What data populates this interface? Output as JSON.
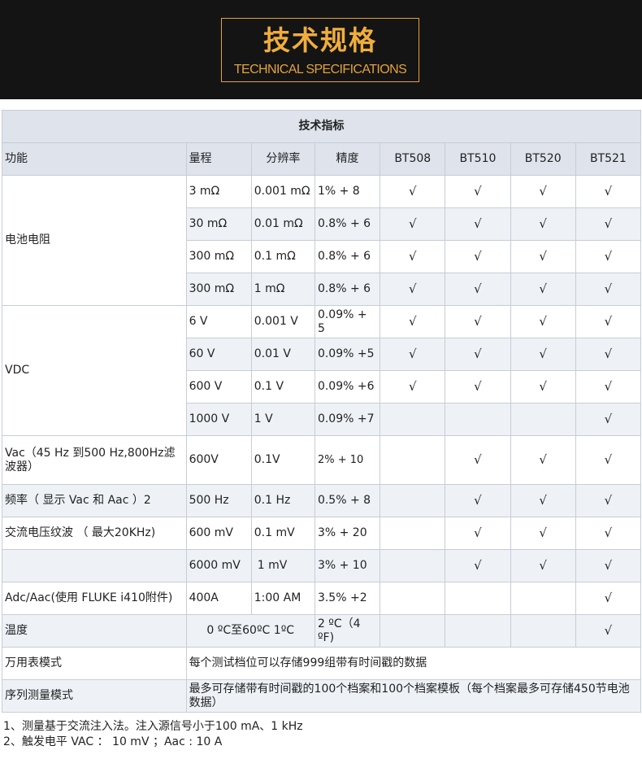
{
  "banner": {
    "title_cn": "技术规格",
    "title_en": "TECHNICAL SPECIFICATIONS"
  },
  "table": {
    "title": "技术指标",
    "headers": [
      "功能",
      "量程",
      "分辨率",
      "精度",
      "BT508",
      "BT510",
      "BT520",
      "BT521"
    ],
    "check": "√",
    "groups": [
      {
        "func": "电池电阻",
        "rows": [
          {
            "range": "3 mΩ",
            "res": "0.001 mΩ",
            "acc": "1% + 8",
            "checks": [
              true,
              true,
              true,
              true
            ]
          },
          {
            "range": "30 mΩ",
            "res": "0.01 mΩ",
            "acc": "0.8% + 6",
            "checks": [
              true,
              true,
              true,
              true
            ]
          },
          {
            "range": "300 mΩ",
            "res": "0.1 mΩ",
            "acc": "0.8% + 6",
            "checks": [
              true,
              true,
              true,
              true
            ]
          },
          {
            "range": "300 mΩ",
            "res": "1 mΩ",
            "acc": "0.8% + 6",
            "checks": [
              true,
              true,
              true,
              true
            ]
          }
        ]
      },
      {
        "func": "VDC",
        "rows": [
          {
            "range": "6 V",
            "res": "0.001 V",
            "acc": "0.09% + 5",
            "checks": [
              true,
              true,
              true,
              true
            ]
          },
          {
            "range": "60 V",
            "res": "0.01 V",
            "acc": "0.09% +5",
            "checks": [
              true,
              true,
              true,
              true
            ]
          },
          {
            "range": "600 V",
            "res": "0.1 V",
            "acc": "0.09% +6",
            "checks": [
              true,
              true,
              true,
              true
            ]
          },
          {
            "range": "1000 V",
            "res": "1 V",
            "acc": "0.09% +7",
            "checks": [
              false,
              false,
              false,
              true
            ]
          }
        ]
      }
    ],
    "vac": {
      "func": "Vac（45 Hz 到500 Hz,800Hz滤波器）",
      "range": "600V",
      "res": "0.1V",
      "acc": "2%  + 10",
      "checks": [
        false,
        true,
        true,
        true
      ]
    },
    "freq": {
      "func": "频率（ 显示 Vac 和 Aac ）2",
      "range": "500 Hz",
      "res": "0.1 Hz",
      "acc": "0.5% + 8",
      "checks": [
        false,
        true,
        true,
        true
      ]
    },
    "ripple": {
      "func": "交流电压纹波 （ 最大20KHz)",
      "range": "600 mV",
      "res": "0.1 mV",
      "acc": "3% + 20",
      "checks": [
        false,
        true,
        true,
        true
      ]
    },
    "ripple2": {
      "func": "",
      "range": "6000 mV",
      "res": "1 mV",
      "acc": "3% + 10",
      "checks": [
        false,
        true,
        true,
        true
      ]
    },
    "adc": {
      "func": "Adc/Aac(使用 FLUKE i410附件)",
      "range": "400A",
      "res": "1:00 AM",
      "acc": "3.5% +2",
      "checks": [
        false,
        false,
        false,
        true
      ]
    },
    "temp": {
      "func": "温度",
      "range_res": "0 ºC至60ºC 1ºC",
      "acc": "2 ºC（4 ºF)",
      "checks": [
        false,
        false,
        false,
        true
      ]
    },
    "dmm": {
      "func": "万用表模式",
      "desc": "每个测试档位可以存储999组带有时间戳的数据"
    },
    "seq": {
      "func": "序列测量模式",
      "desc": "最多可存储带有时间戳的100个档案和100个档案模板（每个档案最多可存储450节电池数据）"
    }
  },
  "notes": [
    "1、测量基于交流注入法。注入源信号小于100 mA、1 kHz",
    "2、触发电平 VAC ： 10 mV ；Aac : 10 A"
  ]
}
